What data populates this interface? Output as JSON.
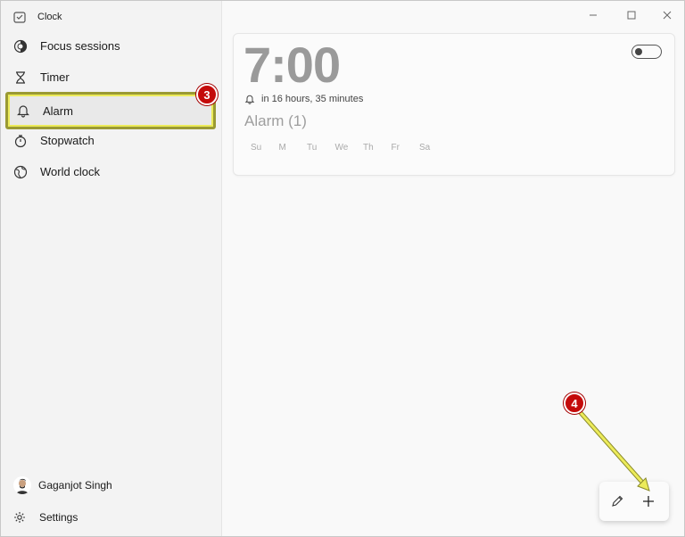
{
  "app": {
    "title": "Clock"
  },
  "sidebar": {
    "items": [
      {
        "label": "Focus sessions",
        "icon": "focus-icon"
      },
      {
        "label": "Timer",
        "icon": "hourglass-icon"
      },
      {
        "label": "Alarm",
        "icon": "bell-icon",
        "active": true
      },
      {
        "label": "Stopwatch",
        "icon": "stopwatch-icon"
      },
      {
        "label": "World clock",
        "icon": "globe-icon"
      }
    ],
    "user_name": "Gaganjot Singh",
    "settings_label": "Settings"
  },
  "alarm": {
    "time": "7:00",
    "remaining": "in 16 hours, 35 minutes",
    "name": "Alarm (1)",
    "days": [
      "Su",
      "M",
      "Tu",
      "We",
      "Th",
      "Fr",
      "Sa"
    ],
    "enabled": false
  },
  "annotations": {
    "step_alarm": "3",
    "step_add": "4"
  },
  "colors": {
    "highlight_outline": "#eceb5a",
    "badge": "#c40b0b"
  }
}
